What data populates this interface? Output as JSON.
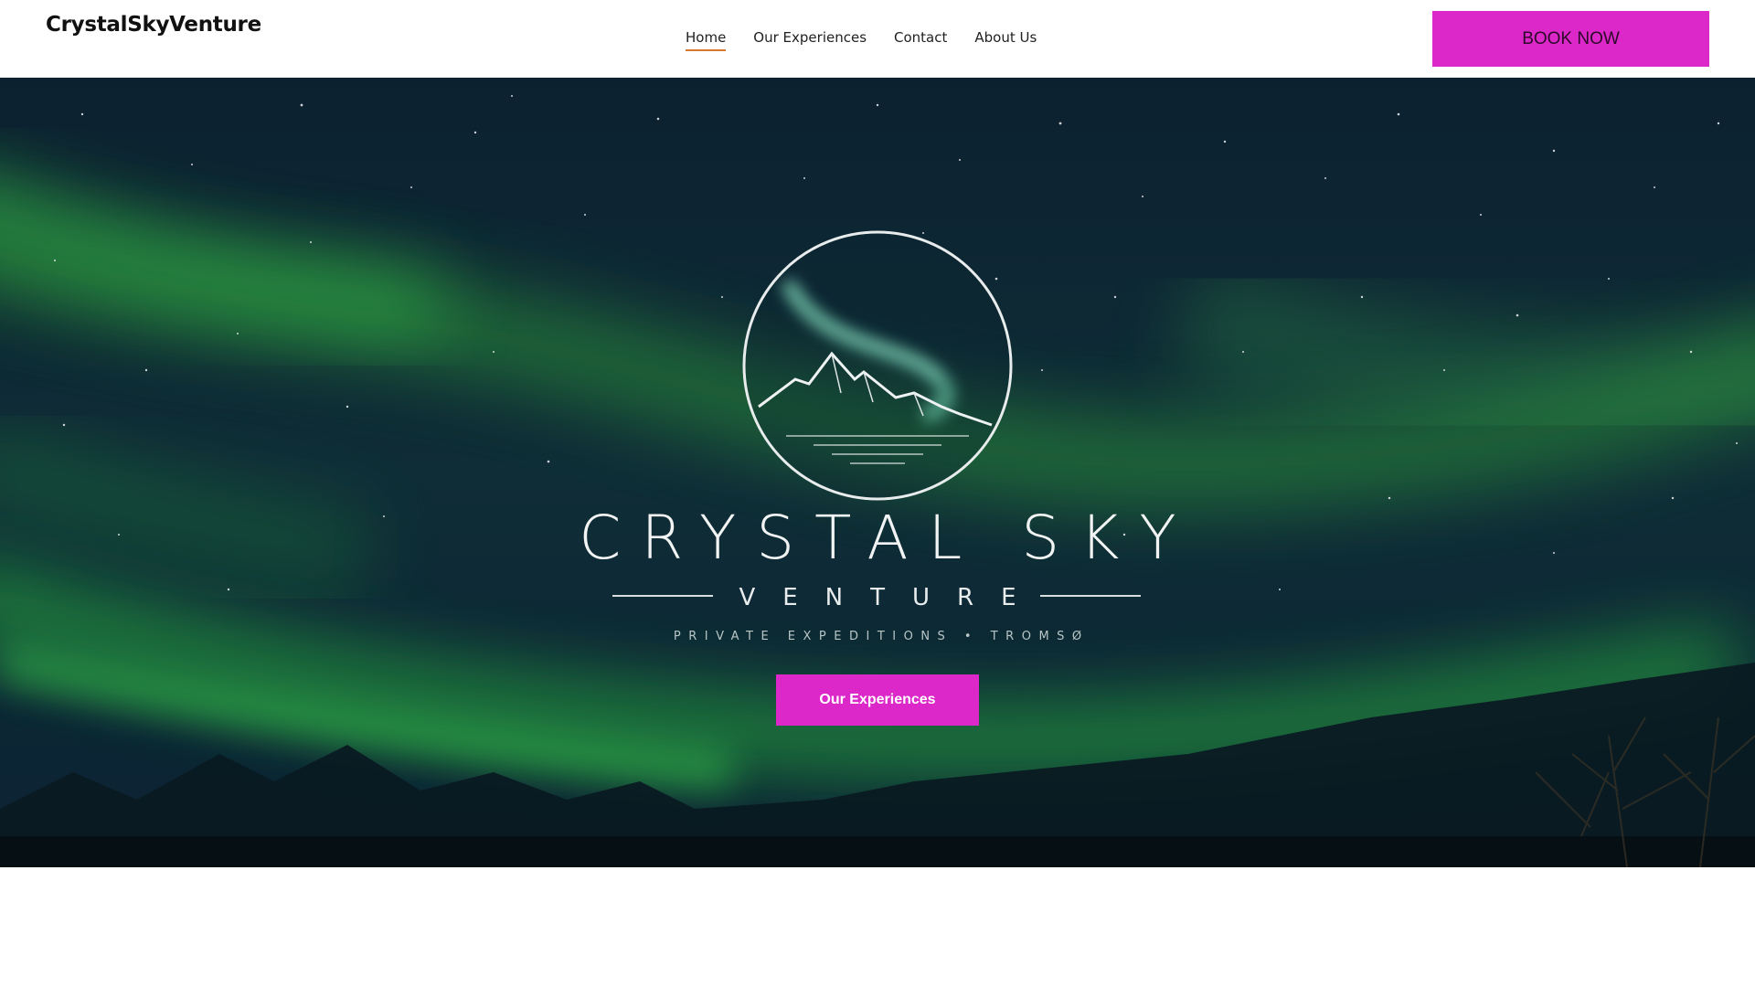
{
  "header": {
    "brand": "CrystalSkyVenture",
    "nav": [
      {
        "label": "Home",
        "active": true
      },
      {
        "label": "Our Experiences",
        "active": false
      },
      {
        "label": "Contact",
        "active": false
      },
      {
        "label": "About Us",
        "active": false
      }
    ],
    "book_button": "BOOK NOW"
  },
  "hero": {
    "logo_title": "CRYSTAL SKY",
    "logo_subtitle": "VENTURE",
    "logo_tagline": "PRIVATE EXPEDITIONS • TROMSØ",
    "cta_button": "Our Experiences"
  },
  "colors": {
    "accent": "#dc27c9",
    "nav_underline": "#d57a2c",
    "aurora_green": "#2fbf3a",
    "sky": "#0a1f2c"
  },
  "icons": [
    "aurora-mountain-logo-icon"
  ]
}
